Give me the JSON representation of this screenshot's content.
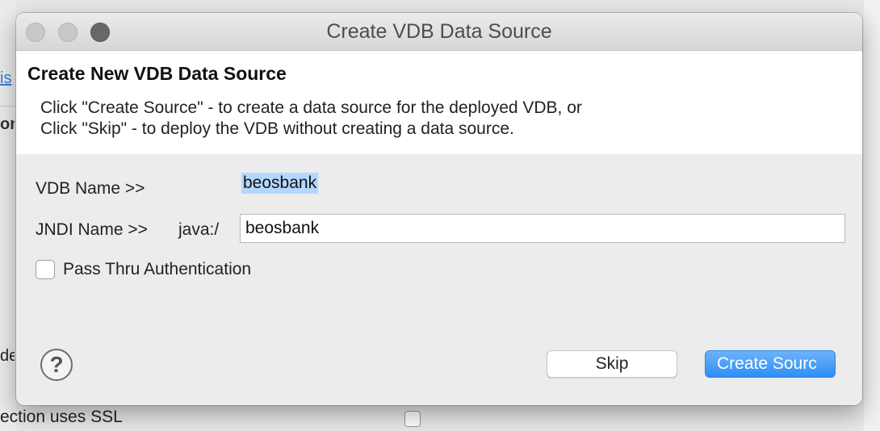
{
  "background": {
    "link_fragment": "is",
    "bold_fragment": "on",
    "text_fragment": "de",
    "ssl_text": "ection uses SSL"
  },
  "window": {
    "title": "Create VDB Data Source"
  },
  "header": {
    "title": "Create New VDB Data Source",
    "line1": "Click \"Create Source\" - to create a data source for the deployed VDB, or",
    "line2": "Click \"Skip\" - to deploy the VDB without creating a data source."
  },
  "form": {
    "vdb_name_label": "VDB Name >>",
    "vdb_name_value": "beosbank",
    "jndi_name_label": "JNDI Name >>",
    "jndi_prefix": "java:/",
    "jndi_value": "beosbank",
    "pass_thru_label": "Pass Thru Authentication",
    "pass_thru_checked": false
  },
  "buttons": {
    "help_glyph": "?",
    "skip_label": "Skip",
    "create_label": "Create Sourc"
  },
  "colors": {
    "accent": "#3b8ff5",
    "selection": "#b3d7ff"
  }
}
